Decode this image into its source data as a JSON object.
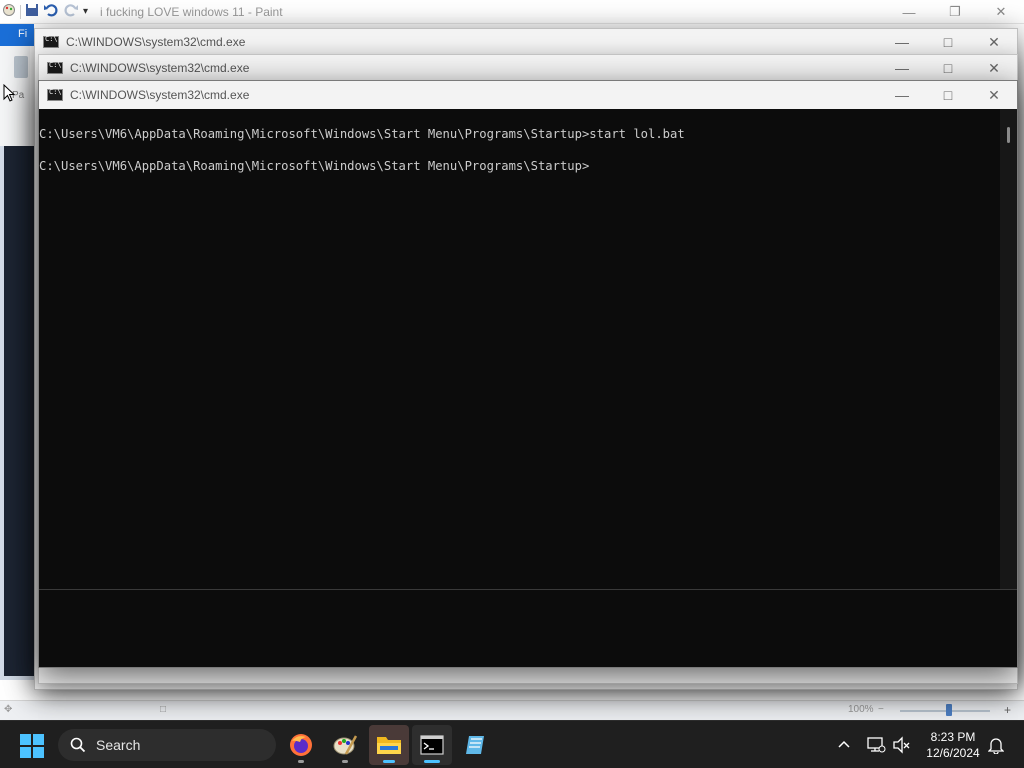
{
  "paint": {
    "title": "i fucking LOVE windows 11 - Paint",
    "file_tab": "Fi",
    "ribbon_label": "Pa",
    "status_zoom": "100%"
  },
  "cmd_windows": [
    {
      "title": "C:\\WINDOWS\\system32\\cmd.exe"
    },
    {
      "title": "C:\\WINDOWS\\system32\\cmd.exe"
    },
    {
      "title": "C:\\WINDOWS\\system32\\cmd.exe"
    }
  ],
  "console": {
    "lines": [
      "C:\\Users\\VM6\\AppData\\Roaming\\Microsoft\\Windows\\Start Menu\\Programs\\Startup>start lol.bat",
      "C:\\Users\\VM6\\AppData\\Roaming\\Microsoft\\Windows\\Start Menu\\Programs\\Startup>"
    ]
  },
  "taskbar": {
    "search_label": "Search",
    "apps": [
      {
        "name": "firefox-icon"
      },
      {
        "name": "paint-icon"
      },
      {
        "name": "file-explorer-icon"
      },
      {
        "name": "command-prompt-icon"
      },
      {
        "name": "notepad-icon"
      }
    ],
    "time": "8:23 PM",
    "date": "12/6/2024"
  },
  "colors": {
    "console_bg": "#0c0c0c",
    "console_text": "#cccccc",
    "taskbar_bg": "#1f1f1f",
    "accent": "#4cc2ff"
  }
}
